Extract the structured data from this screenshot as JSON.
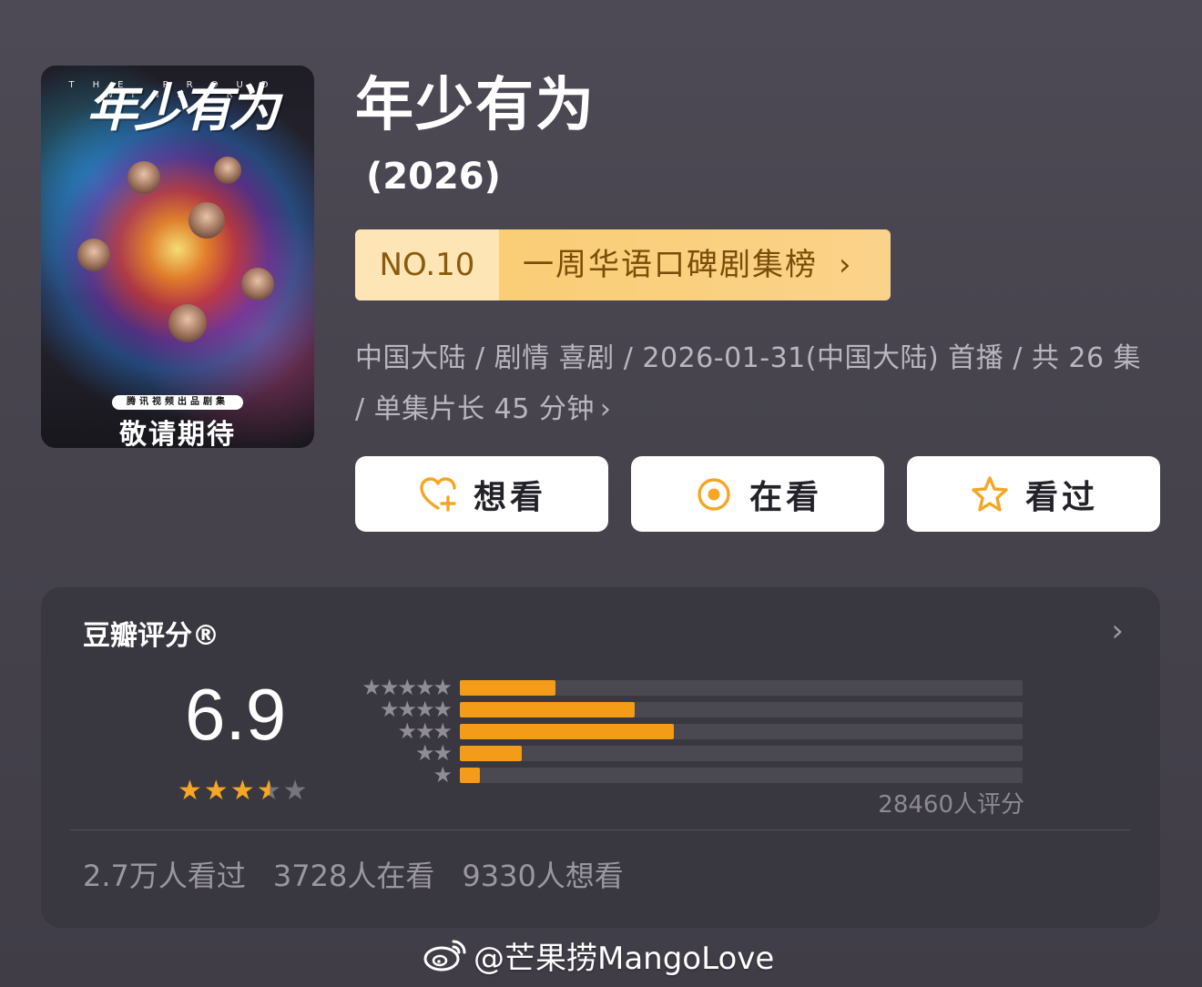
{
  "poster": {
    "title": "年少有为",
    "english": "THE PROUD WINNER",
    "badge": "腾讯视频出品剧集",
    "tagline": "敬请期待"
  },
  "show": {
    "title": "年少有为",
    "year": "(2026)"
  },
  "ranking": {
    "number": "NO.10",
    "label": "一周华语口碑剧集榜",
    "arrow": "›"
  },
  "meta": {
    "text": "中国大陆 / 剧情 喜剧 / 2026-01-31(中国大陆) 首播 / 共 26 集 / 单集片长 45 分钟",
    "arrow": "›"
  },
  "actions": [
    {
      "label": "想看",
      "icon": "heart-plus-icon"
    },
    {
      "label": "在看",
      "icon": "target-circle-icon"
    },
    {
      "label": "看过",
      "icon": "star-outline-icon"
    }
  ],
  "rating": {
    "title": "豆瓣评分®",
    "chevron": "›",
    "score": "6.9",
    "stars": 3.5,
    "count_label": "28460人评分",
    "distribution": [
      {
        "stars": 5,
        "fraction": 0.17
      },
      {
        "stars": 4,
        "fraction": 0.31
      },
      {
        "stars": 3,
        "fraction": 0.38
      },
      {
        "stars": 2,
        "fraction": 0.11
      },
      {
        "stars": 1,
        "fraction": 0.035
      }
    ],
    "stats": {
      "watched": "2.7万人看过",
      "watching": "3728人在看",
      "wish": "9330人想看"
    }
  },
  "watermark": {
    "text": "@芒果捞MangoLove",
    "icon": "weibo-icon"
  },
  "colors": {
    "accent": "#f49b17",
    "rank_bg": "#f9cc6e",
    "panel_bg": "#39373f"
  }
}
